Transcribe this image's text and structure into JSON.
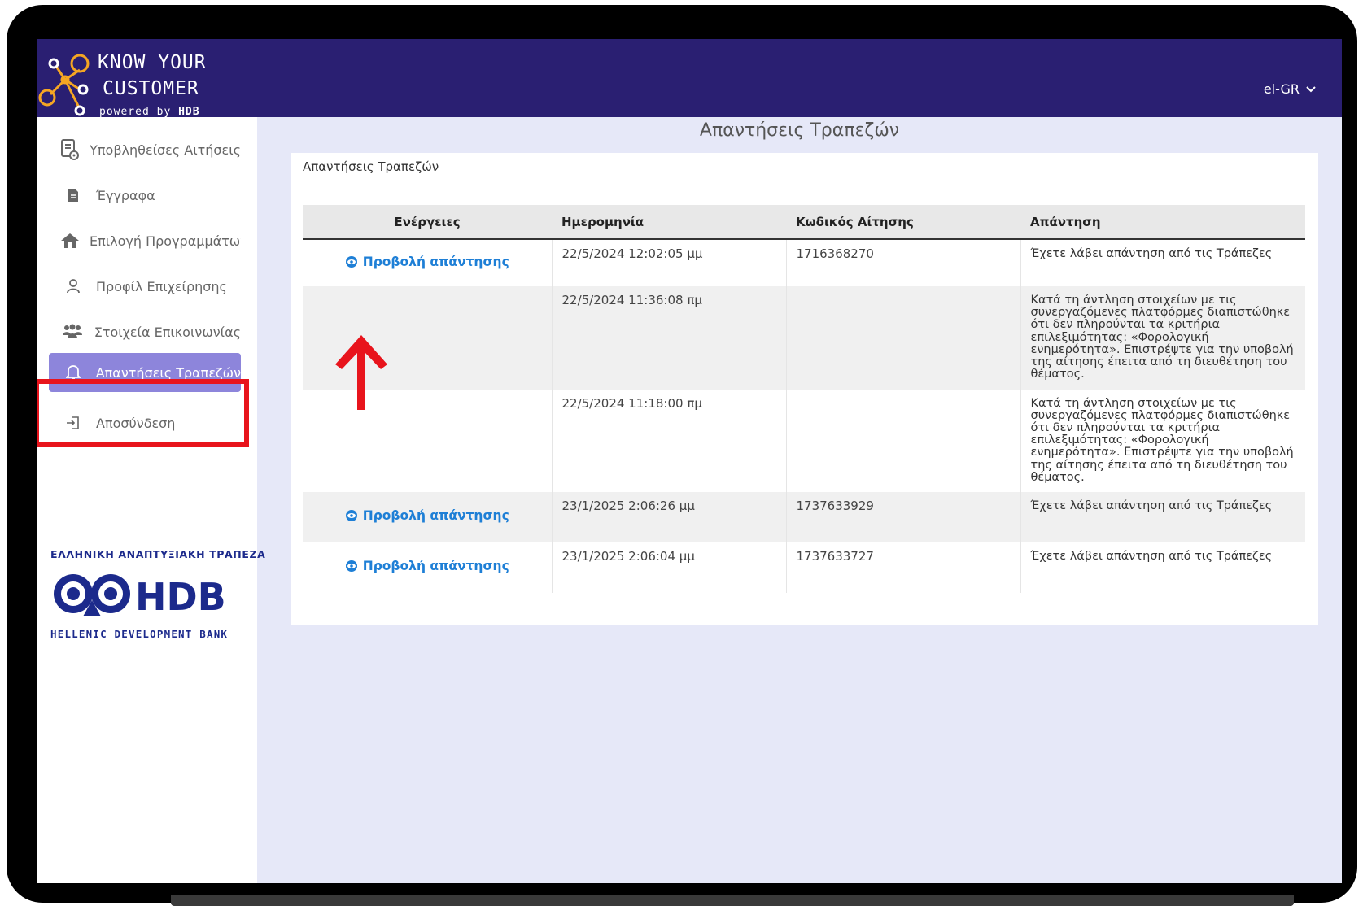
{
  "header": {
    "logo_line1": "KNOW YOUR",
    "logo_line2": "CUSTOMER",
    "logo_powered": "powered by",
    "logo_brand": "HDB",
    "language": "el-GR"
  },
  "sidebar": {
    "items": [
      {
        "label": "Υποβληθείσες Αιτήσεις",
        "icon": "document-eye-icon"
      },
      {
        "label": "Έγγραφα",
        "icon": "file-icon"
      },
      {
        "label": "Επιλογή Προγραμμάτων",
        "icon": "home-icon"
      },
      {
        "label": "Προφίλ Επιχείρησης",
        "icon": "user-icon"
      },
      {
        "label": "Στοιχεία Επικοινωνίας",
        "icon": "users-icon"
      },
      {
        "label": "Απαντήσεις Τραπεζών",
        "icon": "bell-icon"
      },
      {
        "label": "Αποσύνδεση",
        "icon": "logout-icon"
      }
    ],
    "bank_greek": "ΕΛΛΗΝΙΚΗ ΑΝΑΠΤΥΞΙΑΚΗ ΤΡΑΠΕΖΑ",
    "bank_short": "HDB",
    "bank_english": "HELLENIC DEVELOPMENT BANK"
  },
  "main": {
    "title": "Απαντήσεις Τραπεζών",
    "card_title": "Απαντήσεις Τραπεζών",
    "columns": [
      "Ενέργειες",
      "Ημερομηνία",
      "Κωδικός Αίτησης",
      "Απάντηση"
    ],
    "rows": [
      {
        "action": "Προβολή απάντησης",
        "date": "22/5/2024 12:02:05 μμ",
        "code": "1716368270",
        "response": "Έχετε λάβει απάντηση από τις Τράπεζες"
      },
      {
        "action": "",
        "date": "22/5/2024 11:36:08 πμ",
        "code": "",
        "response": "Κατά τη άντληση στοιχείων με τις συνεργαζόμενες πλατφόρμες διαπιστώθηκε ότι δεν πληρούνται τα κριτήρια επιλεξιμότητας: «Φορολογική ενημερότητα». Επιστρέψτε για την υποβολή της αίτησης έπειτα από τη διευθέτηση του θέματος."
      },
      {
        "action": "",
        "date": "22/5/2024 11:18:00 πμ",
        "code": "",
        "response": "Κατά τη άντληση στοιχείων με τις συνεργαζόμενες πλατφόρμες διαπιστώθηκε ότι δεν πληρούνται τα κριτήρια επιλεξιμότητας: «Φορολογική ενημερότητα». Επιστρέψτε για την υποβολή της αίτησης έπειτα από τη διευθέτηση του θέματος."
      },
      {
        "action": "Προβολή απάντησης",
        "date": "23/1/2025 2:06:26 μμ",
        "code": "1737633929",
        "response": "Έχετε λάβει απάντηση από τις Τράπεζες"
      },
      {
        "action": "Προβολή απάντησης",
        "date": "23/1/2025 2:06:04 μμ",
        "code": "1737633727",
        "response": "Έχετε λάβει απάντηση από τις Τράπεζες"
      }
    ]
  },
  "colors": {
    "header_bg": "#2a1f72",
    "active_item": "#8d85db",
    "link": "#1e7fd6",
    "highlight": "#e8141c",
    "screen_bg": "#e6e8f8"
  }
}
